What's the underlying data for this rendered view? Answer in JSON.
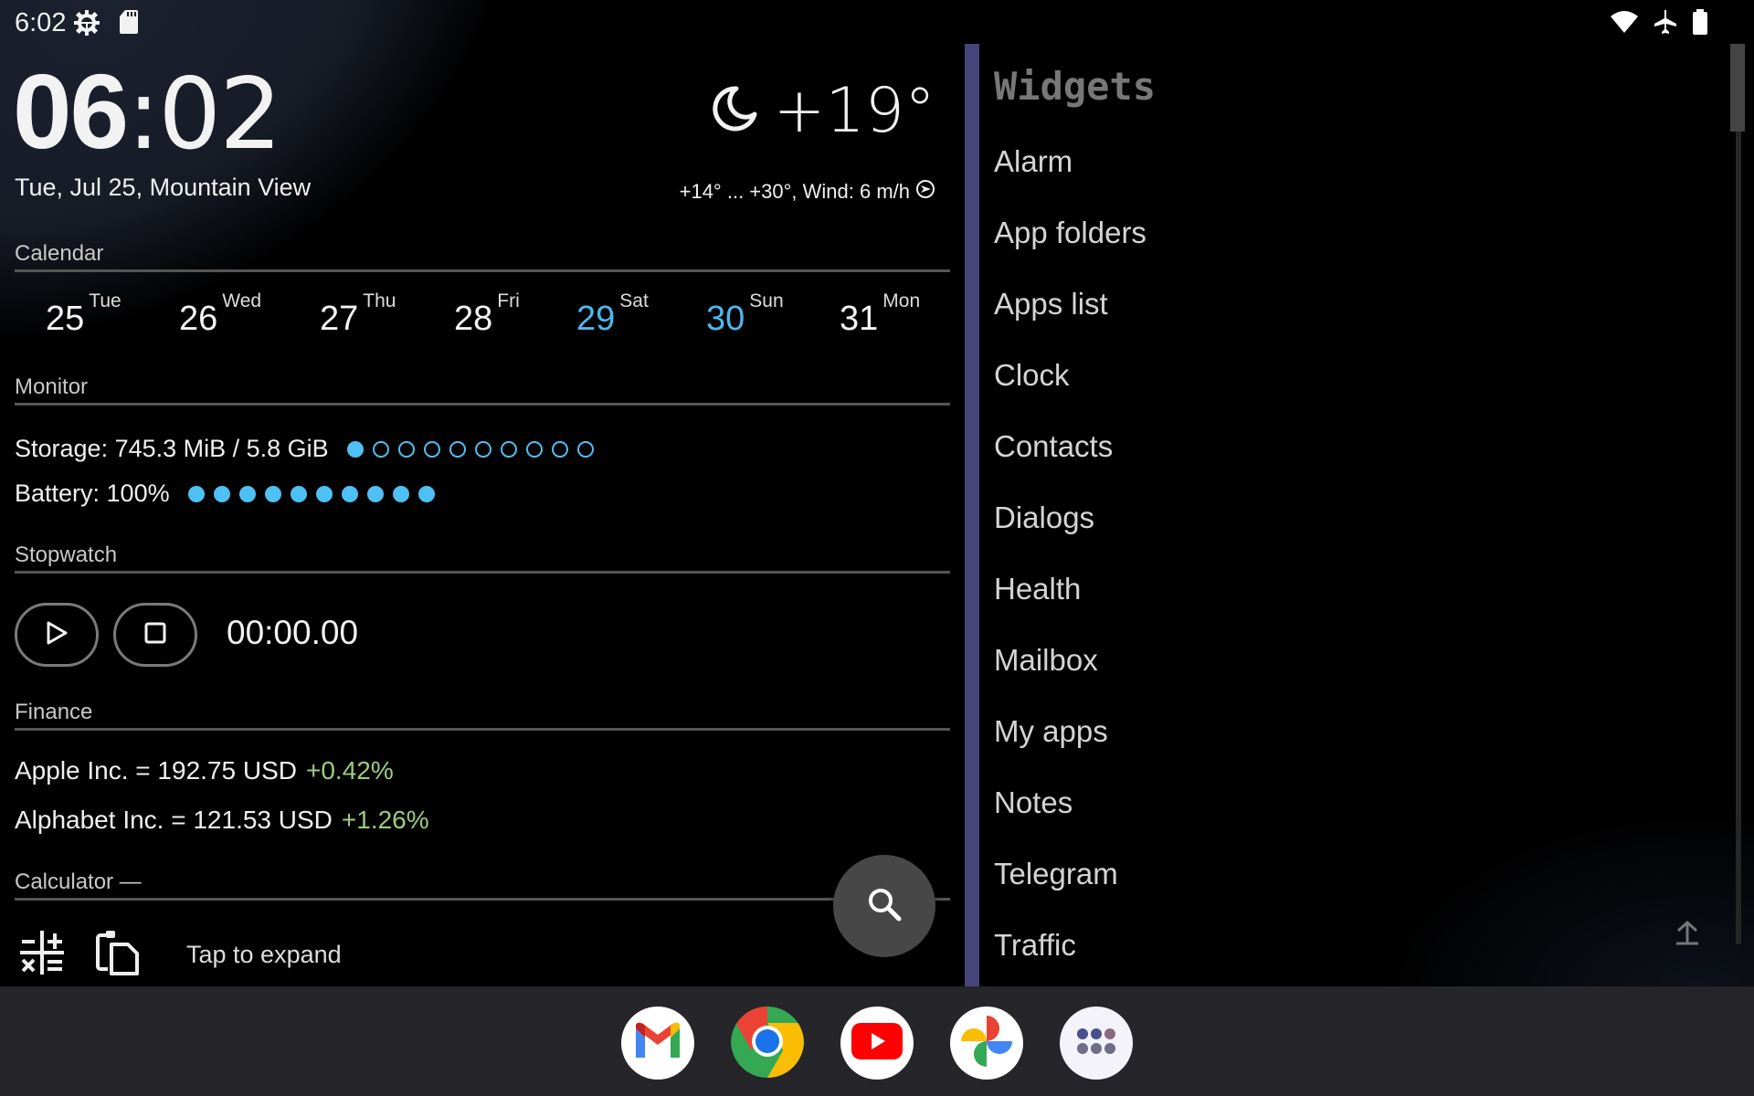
{
  "status_bar": {
    "time": "6:02",
    "left_icons": [
      "android-settings-gear-icon",
      "sd-card-icon"
    ],
    "right_icons": [
      "wifi-icon",
      "airplane-mode-icon",
      "battery-full-icon"
    ]
  },
  "clock": {
    "hours": "06",
    "separator": ":",
    "minutes": "02",
    "date_location": "Tue, Jul 25, Mountain View"
  },
  "weather": {
    "icon": "moon-icon",
    "temperature": "+19°",
    "details": "+14° ... +30°, Wind: 6 m/h",
    "wind_icon": "wind-direction-icon"
  },
  "calendar": {
    "title": "Calendar",
    "days": [
      {
        "num": "25",
        "dow": "Tue",
        "weekend": false
      },
      {
        "num": "26",
        "dow": "Wed",
        "weekend": false
      },
      {
        "num": "27",
        "dow": "Thu",
        "weekend": false
      },
      {
        "num": "28",
        "dow": "Fri",
        "weekend": false
      },
      {
        "num": "29",
        "dow": "Sat",
        "weekend": true
      },
      {
        "num": "30",
        "dow": "Sun",
        "weekend": true
      },
      {
        "num": "31",
        "dow": "Mon",
        "weekend": false
      }
    ],
    "weekend_color": "#4fb6ee"
  },
  "monitor": {
    "title": "Monitor",
    "storage_label": "Storage: 745.3 MiB / 5.8 GiB",
    "storage_filled_dots": 1,
    "storage_total_dots": 10,
    "battery_label": "Battery: 100%",
    "battery_filled_dots": 10,
    "battery_total_dots": 10,
    "dot_color": "#4fc0f4"
  },
  "stopwatch": {
    "title": "Stopwatch",
    "time": "00:00.00",
    "play_icon": "play-icon",
    "stop_icon": "stop-icon"
  },
  "finance": {
    "title": "Finance",
    "rows": [
      {
        "label": "Apple Inc. = 192.75 USD",
        "change": "+0.42%"
      },
      {
        "label": "Alphabet Inc. = 121.53 USD",
        "change": "+1.26%"
      }
    ],
    "positive_color": "#9ccc7f"
  },
  "calculator": {
    "title": "Calculator —",
    "tap_text": "Tap to expand"
  },
  "search_fab": {
    "icon": "search-icon"
  },
  "widgets_panel": {
    "title": "Widgets",
    "items": [
      "Alarm",
      "App folders",
      "Apps list",
      "Clock",
      "Contacts",
      "Dialogs",
      "Health",
      "Mailbox",
      "My apps",
      "Notes",
      "Telegram",
      "Traffic"
    ],
    "accent_color": "#45457a",
    "scroll_top_icon": "scroll-to-top-icon"
  },
  "dock": {
    "apps": [
      {
        "name": "Gmail",
        "icon": "gmail-icon"
      },
      {
        "name": "Chrome",
        "icon": "chrome-icon"
      },
      {
        "name": "YouTube",
        "icon": "youtube-icon"
      },
      {
        "name": "Photos",
        "icon": "google-photos-icon"
      },
      {
        "name": "All apps",
        "icon": "app-drawer-icon"
      }
    ]
  }
}
